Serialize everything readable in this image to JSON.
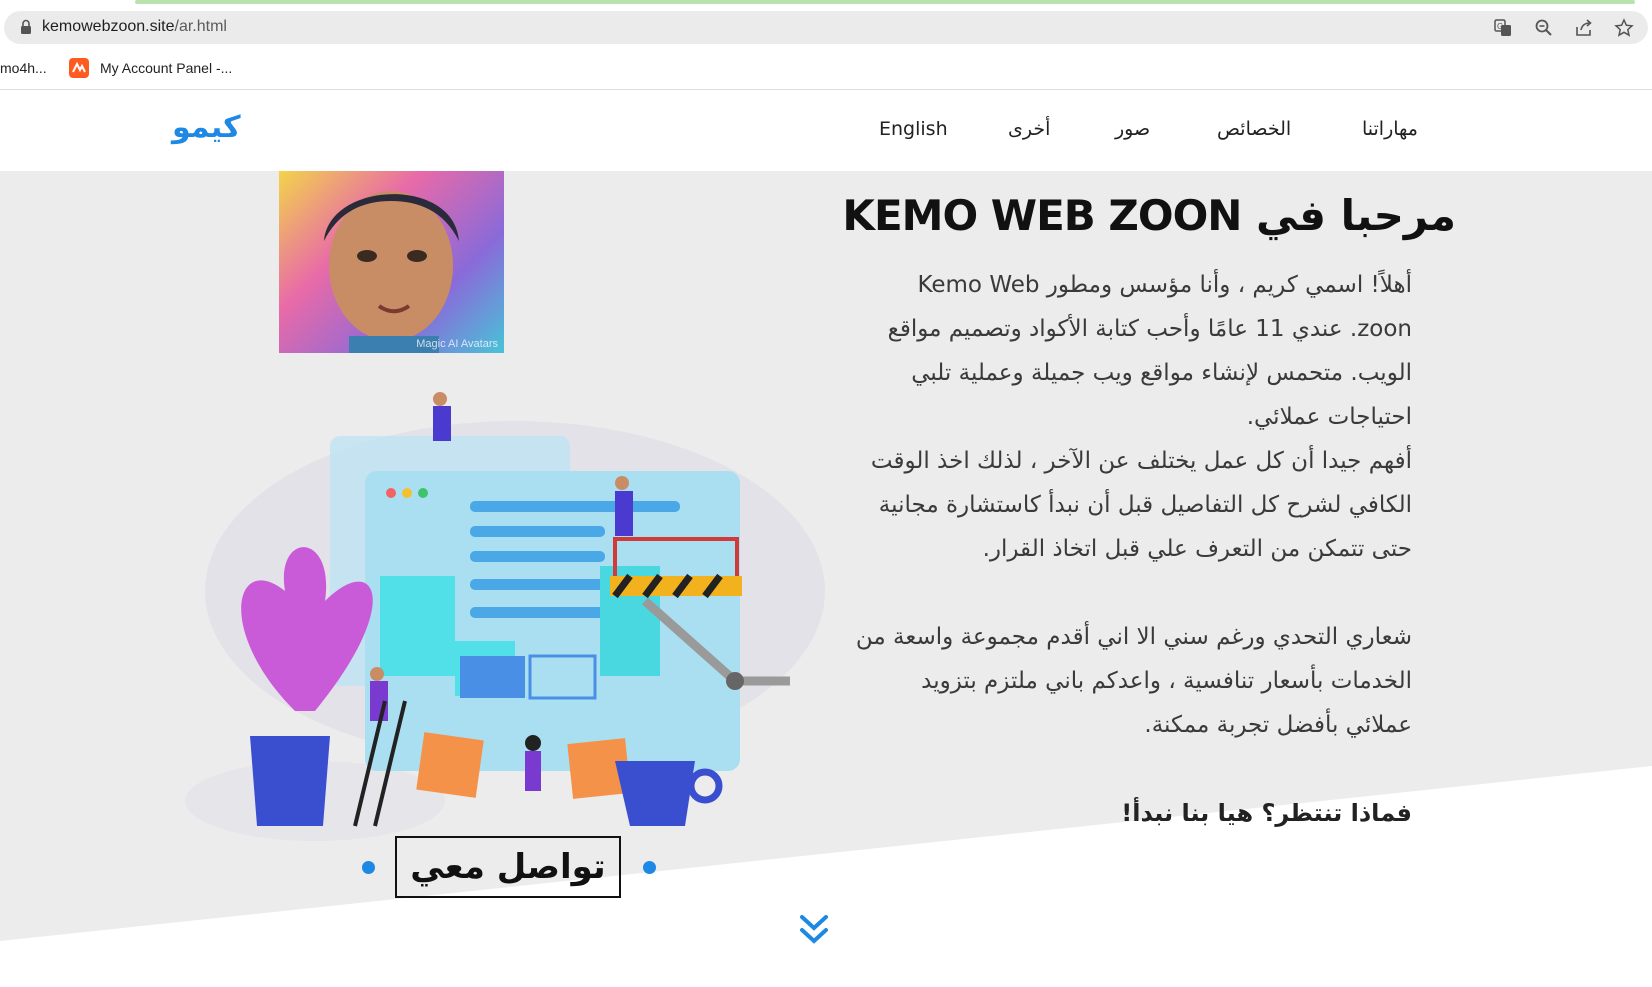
{
  "browser": {
    "url_domain": "kemowebzoon.site",
    "url_path": "/ar.html",
    "bookmarks": [
      {
        "label": "mo4h..."
      },
      {
        "label": "My Account Panel -..."
      }
    ]
  },
  "nav": {
    "brand": "كيمو",
    "links": [
      "مهاراتنا",
      "الخصائص",
      "صور",
      "أخرى",
      "English"
    ]
  },
  "hero": {
    "title": "مرحبا في KEMO WEB ZOON",
    "paragraph_1": "أهلاً! اسمي كريم ، وأنا مؤسس ومطور Kemo Web zoon. عندي 11 عامًا وأحب كتابة الأكواد وتصميم مواقع الويب. متحمس لإنشاء مواقع ويب جميلة وعملية تلبي احتياجات عملائي.",
    "paragraph_2": "أفهم جيدا أن كل عمل يختلف عن الآخر ، لذلك اخذ الوقت الكافي لشرح كل التفاصيل قبل أن نبدأ كاستشارة مجانية حتى تتمكن من التعرف علي قبل اتخاذ القرار.",
    "paragraph_3": "شعاري التحدي ورغم سني الا اني أقدم مجموعة واسعة من الخدمات بأسعار تنافسية ، واعدكم باني ملتزم بتزويد عملائي بأفضل تجربة ممكنة.",
    "cta_text": "فماذا تنتظر؟ هيا بنا نبدأ!",
    "contact_button": "تواصل معي",
    "avatar_caption": "Magic AI Avatars"
  },
  "colors": {
    "accent": "#1e88e5",
    "hero_bg": "#ececec"
  }
}
